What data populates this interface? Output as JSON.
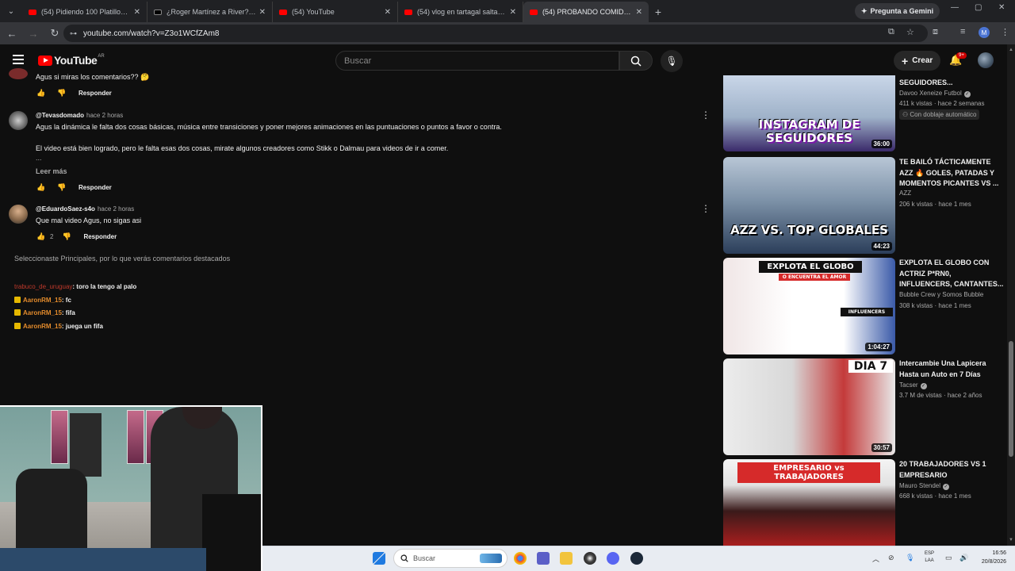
{
  "browser": {
    "tabs": [
      {
        "label": "(54) Pidiendo 100 Platillos Justo",
        "icon": "youtube"
      },
      {
        "label": "¿Roger Martínez a River? Últim",
        "icon": "tiktok"
      },
      {
        "label": "(54) YouTube",
        "icon": "youtube"
      },
      {
        "label": "(54) vlog en tartagal salta - You",
        "icon": "youtube"
      },
      {
        "label": "(54) PROBANDO COMIDA CALL",
        "icon": "youtube"
      }
    ],
    "gemini_label": "Pregunta a Gemini",
    "url": "youtube.com/watch?v=Z3o1WCfZAm8",
    "profile_initial": "M"
  },
  "header": {
    "logo_text": "YouTube",
    "logo_country": "AR",
    "search_placeholder": "Buscar",
    "create_label": "Crear",
    "notif_badge": "9+"
  },
  "comments": [
    {
      "text": "Agus si miras los comentarios?? 🤔",
      "reply_label": "Responder"
    },
    {
      "handle": "@Tevasdomado",
      "time": "hace 2 horas",
      "lines": [
        "Agus la dinámica le falta dos cosas básicas, música entre transiciones y poner mejores animaciones en las puntuaciones o puntos a favor o contra.",
        "El video está bien logrado, pero le falta esas dos cosas, mirate algunos creadores como Stikk o  Dalmau para videos de ir a comer.",
        "..."
      ],
      "read_more": "Leer más",
      "reply_label": "Responder"
    },
    {
      "handle": "@EduardoSaez-s4o",
      "time": "hace 2 horas",
      "text": "Que mal video Agus, no sigas asi",
      "likes": "2",
      "reply_label": "Responder"
    }
  ],
  "selection_note": "Seleccionaste Principales, por lo que verás comentarios destacados",
  "chat": [
    {
      "user": "trabuco_de_uruguay",
      "msg": ": toro la tengo al palo",
      "icon": false
    },
    {
      "user": "AaronRM_15",
      "msg": ": fc",
      "icon": true
    },
    {
      "user": "AaronRM_15",
      "msg": ": fifa",
      "icon": true
    },
    {
      "user": "AaronRM_15",
      "msg": ": juega un fifa",
      "icon": true
    }
  ],
  "sidebar": [
    {
      "title": "SEGUIDORES...",
      "channel": "Davoo Xeneize Futbol",
      "verified": true,
      "meta": "411 k vistas · hace 2 semanas",
      "extra": "Con doblaje automático",
      "thumb_text": "INSTAGRAM DE SEGUIDORES",
      "duration": "36:00"
    },
    {
      "title": "TE BAILÓ TÁCTICAMENTE AZZ 🔥 GOLES, PATADAS Y MOMENTOS PICANTES VS ...",
      "channel": "AZZ",
      "verified": false,
      "meta": "206 k vistas · hace 1 mes",
      "thumb_text": "AZZ VS. TOP GLOBALES",
      "duration": "44:23"
    },
    {
      "title": "EXPLOTA EL GLOBO CON ACTRIZ P*RN0, INFLUENCERS, CANTANTES...",
      "channel": "Bubble Crew y Somos Bubble",
      "verified": false,
      "meta": "308 k vistas · hace 1 mes",
      "thumb_text": "EXPLOTA EL GLOBO",
      "thumb_sub": "O ENCUENTRA EL AMOR",
      "thumb_tag": "INFLUENCERS",
      "duration": "1:04:27"
    },
    {
      "title": "Intercambie Una Lapicera Hasta un Auto en 7 Días",
      "channel": "Tacser",
      "verified": true,
      "meta": "3.7 M de vistas · hace 2 años",
      "thumb_text": "DIA 7",
      "duration": "30:57"
    },
    {
      "title": "20 TRABAJADORES VS 1 EMPRESARIO",
      "channel": "Mauro Stendel",
      "verified": true,
      "meta": "668 k vistas · hace 1 mes",
      "thumb_text": "EMPRESARIO vs TRABAJADORES"
    }
  ],
  "taskbar": {
    "search_label": "Buscar",
    "lang_line1": "ESP",
    "lang_line2": "LAA",
    "time": "16:56",
    "date": "20/8/2026"
  }
}
